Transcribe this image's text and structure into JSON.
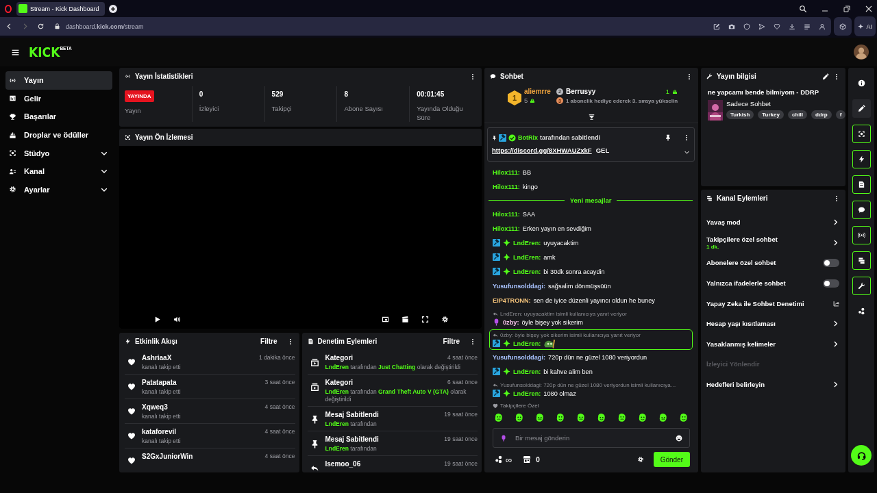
{
  "browser": {
    "tab_title": "Stream - Kick Dashboard",
    "url": "dashboard.**kick.com**/stream",
    "ai_label": "AI"
  },
  "header": {
    "logo": "KICK",
    "logo_badge": "BETA"
  },
  "sidebar": {
    "items": [
      {
        "kind": "broadcast",
        "label": "Yayın",
        "selected": true,
        "expandable": false
      },
      {
        "kind": "revenue",
        "label": "Gelir",
        "selected": false,
        "expandable": false
      },
      {
        "kind": "trophy",
        "label": "Başarılar",
        "selected": false,
        "expandable": false
      },
      {
        "kind": "drops",
        "label": "Droplar ve ödüller",
        "selected": false,
        "expandable": false
      },
      {
        "kind": "studio",
        "label": "Stüdyo",
        "selected": false,
        "expandable": true
      },
      {
        "kind": "channel",
        "label": "Kanal",
        "selected": false,
        "expandable": true
      },
      {
        "kind": "settings",
        "label": "Ayarlar",
        "selected": false,
        "expandable": true
      }
    ]
  },
  "stats": {
    "title": "Yayın İstatistikleri",
    "items": [
      {
        "kind": "status",
        "value": "YAYINDA",
        "label": "Yayın"
      },
      {
        "kind": "number",
        "value": "0",
        "label": "İzleyici"
      },
      {
        "kind": "number",
        "value": "529",
        "label": "Takipçi"
      },
      {
        "kind": "number",
        "value": "8",
        "label": "Abone Sayısı"
      },
      {
        "kind": "number",
        "value": "00:01:45",
        "label": "Yayında Olduğu Süre"
      }
    ]
  },
  "preview": {
    "title": "Yayın Ön İzlemesi"
  },
  "activity": {
    "title": "Etkinlik Akışı",
    "filter": "Filtre",
    "items": [
      {
        "name": "AshriaaX",
        "time": "1 dakika önce",
        "action": "kanalı takip etti"
      },
      {
        "name": "Patatapata",
        "time": "3 saat önce",
        "action": "kanalı takip etti"
      },
      {
        "name": "Xqweq3",
        "time": "4 saat önce",
        "action": "kanalı takip etti"
      },
      {
        "name": "kataforevil",
        "time": "4 saat önce",
        "action": "kanalı takip etti"
      },
      {
        "name": "S2GxJuniorWin",
        "time": "4 saat önce"
      }
    ]
  },
  "moderation": {
    "title": "Denetim Eylemleri",
    "filter": "Filtre",
    "items": [
      {
        "kind": "category",
        "title": "Kategori",
        "time": "4 saat önce",
        "detail": [
          {
            "text": "LndEren",
            "highlight": true
          },
          {
            "text": " tarafından ",
            "highlight": false
          },
          {
            "text": "Just Chatting",
            "highlight": true
          },
          {
            "text": " olarak değiştirildi",
            "highlight": false
          }
        ]
      },
      {
        "kind": "category",
        "title": "Kategori",
        "time": "6 saat önce",
        "detail": [
          {
            "text": "LndEren",
            "highlight": true
          },
          {
            "text": " tarafından ",
            "highlight": false
          },
          {
            "text": "Grand Theft Auto V (GTA)",
            "highlight": true
          },
          {
            "text": " olarak değiştirildi",
            "highlight": false
          }
        ]
      },
      {
        "kind": "pin",
        "title": "Mesaj Sabitlendi",
        "time": "19 saat önce",
        "detail": [
          {
            "text": "LndEren",
            "highlight": true
          },
          {
            "text": " tarafından",
            "highlight": false
          }
        ]
      },
      {
        "kind": "pin",
        "title": "Mesaj Sabitlendi",
        "time": "19 saat önce",
        "detail": [
          {
            "text": "LndEren",
            "highlight": true
          },
          {
            "text": " tarafından",
            "highlight": false
          }
        ]
      },
      {
        "kind": "undo",
        "title": "Isemoo_06",
        "time": "19 saat önce"
      }
    ]
  },
  "chat": {
    "title": "Sohbet",
    "leaders": [
      {
        "rank": "1",
        "name": "aliemrre",
        "count": "5"
      },
      {
        "rank": "2",
        "name": "Berrusyy",
        "count": "1"
      }
    ],
    "promo": {
      "rank": "3",
      "text": "1 abonelik hediye ederek 3. sıraya yükselin"
    },
    "pinned": {
      "by": "BotRix",
      "by_suffix": "tarafından sabitlendi",
      "link": "https://discord.gg/8XHWAUZxkF",
      "text": "GEL"
    },
    "messages": [
      {
        "kind": "message",
        "user": "Hilox111:",
        "color": "#53fc18",
        "text": "BB",
        "highlighted": false
      },
      {
        "kind": "message",
        "user": "Hilox111:",
        "color": "#53fc18",
        "text": "kingo",
        "highlighted": false
      },
      {
        "kind": "divider",
        "text": "Yeni mesajlar"
      },
      {
        "kind": "message",
        "user": "Hilox111:",
        "color": "#53fc18",
        "text": "SAA",
        "highlighted": false
      },
      {
        "kind": "message",
        "user": "Hilox111:",
        "color": "#53fc18",
        "text": "Erken yayın en sevdiğim",
        "highlighted": false
      },
      {
        "kind": "message",
        "user": "LndEren:",
        "color": "#53fc18",
        "badges": [
          {
            "kind": "moderator"
          },
          {
            "kind": "subscriber"
          }
        ],
        "text": "uyuyacaktim",
        "highlighted": false
      },
      {
        "kind": "message",
        "user": "LndEren:",
        "color": "#53fc18",
        "badges": [
          {
            "kind": "moderator"
          },
          {
            "kind": "subscriber"
          }
        ],
        "text": "amk",
        "highlighted": false
      },
      {
        "kind": "message",
        "user": "LndEren:",
        "color": "#53fc18",
        "badges": [
          {
            "kind": "moderator"
          },
          {
            "kind": "subscriber"
          }
        ],
        "text": "bi 30dk sonra acaydin",
        "highlighted": false
      },
      {
        "kind": "message",
        "user": "Yusufunsolddagi:",
        "color": "#a9c3ff",
        "text": "sağsalim dönmüşsüün",
        "highlighted": false
      },
      {
        "kind": "message",
        "user": "EIP4TRONN:",
        "color": "#f2c27a",
        "text": "sen de iyice düzenli yayıncı oldun he buney",
        "highlighted": false
      },
      {
        "kind": "message",
        "reply": "LndEren: uyuyacaktim isimli kullanıcıya yanıt veriyor",
        "user": "0zby:",
        "color": "#f5c2ea",
        "badges": [
          {
            "kind": "microphone"
          }
        ],
        "text": "öyle bişey yok sikerim",
        "highlighted": false
      },
      {
        "kind": "message",
        "reply": "0zby: öyle bişey yok sikerim isimli kullanıcıya yanıt veriyor",
        "user": "LndEren:",
        "color": "#53fc18",
        "badges": [
          {
            "kind": "moderator"
          },
          {
            "kind": "subscriber"
          }
        ],
        "emote": true,
        "highlighted": true
      },
      {
        "kind": "message",
        "user": "Yusufunsolddagi:",
        "color": "#a9c3ff",
        "text": "720p dün ne güzel 1080 veriyordun",
        "highlighted": false
      },
      {
        "kind": "message",
        "user": "LndEren:",
        "color": "#53fc18",
        "badges": [
          {
            "kind": "moderator"
          },
          {
            "kind": "subscriber"
          }
        ],
        "text": "bi kahve alim ben",
        "highlighted": false
      },
      {
        "kind": "message",
        "reply": "Yusufunsolddagi: 720p dün ne güzel 1080 veriyordun isimli kullanıcıya…",
        "user": "LndEren:",
        "color": "#53fc18",
        "badges": [
          {
            "kind": "moderator"
          },
          {
            "kind": "subscriber"
          }
        ],
        "text": "1080 olmaz",
        "highlighted": false
      }
    ],
    "emote_section": "Takipçilere Özel",
    "input": {
      "placeholder": "Bir mesaj gönderin"
    },
    "drops": "∞",
    "shop_count": "0",
    "send": "Gönder"
  },
  "stream_info": {
    "title": "Yayın bilgisi",
    "stream_title": "ne yapcamı bende bilmiyom - DDRP",
    "category": "Sadece Sohbet",
    "tags": [
      "Turkish",
      "Turkey",
      "chill",
      "ddrp",
      "f"
    ]
  },
  "channel_actions": {
    "title": "Kanal Eylemleri",
    "items": [
      {
        "kind": "submenu",
        "label": "Yavaş mod",
        "disabled": false
      },
      {
        "kind": "submenu",
        "label": "Takipçilere özel sohbet",
        "value": "1 dk.",
        "disabled": false
      },
      {
        "kind": "toggle",
        "label": "Abonelere özel sohbet",
        "on": false,
        "disabled": false
      },
      {
        "kind": "toggle",
        "label": "Yalnızca ifadelerle sohbet",
        "on": false,
        "disabled": false
      },
      {
        "kind": "external",
        "label": "Yapay Zeka ile Sohbet Denetimi",
        "disabled": false
      },
      {
        "kind": "submenu",
        "label": "Hesap yaşı kısıtlaması",
        "disabled": false
      },
      {
        "kind": "submenu",
        "label": "Yasaklanmış kelimeler",
        "disabled": false
      },
      {
        "kind": "plain",
        "label": "İzleyici Yönlendir",
        "disabled": true
      },
      {
        "kind": "submenu",
        "label": "Hedefleri belirleyin",
        "disabled": false
      }
    ]
  },
  "rail": [
    {
      "kind": "info",
      "active": false
    },
    {
      "kind": "edit",
      "active": false
    },
    {
      "kind": "preview",
      "active": true
    },
    {
      "kind": "activity",
      "active": true
    },
    {
      "kind": "moderation",
      "active": true
    },
    {
      "kind": "chat",
      "active": true
    },
    {
      "kind": "stats",
      "active": true
    },
    {
      "kind": "actions",
      "active": true
    },
    {
      "kind": "wrench",
      "active": true
    },
    {
      "kind": "drops",
      "active": false
    }
  ]
}
